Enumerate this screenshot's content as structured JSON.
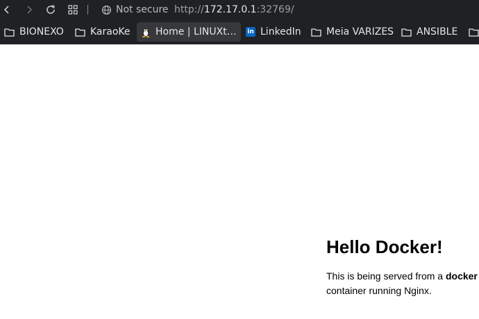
{
  "browser": {
    "security_label": "Not secure",
    "url": {
      "scheme": "http://",
      "host": "172.17.0.1",
      "rest": ":32769/"
    },
    "icons": {
      "back": "arrow-left-icon",
      "forward": "arrow-right-icon",
      "reload": "reload-icon",
      "apps": "apps-grid-icon",
      "security": "globe-icon"
    }
  },
  "bookmarks": [
    {
      "label": "BIONEXO",
      "icon": "folder-icon"
    },
    {
      "label": "KaraoKe",
      "icon": "folder-icon"
    },
    {
      "label": "Home | LINUXt…",
      "icon": "tux-icon"
    },
    {
      "label": "LinkedIn",
      "icon": "linkedin-icon",
      "badge": "in"
    },
    {
      "label": "Meia VARIZES",
      "icon": "folder-icon"
    },
    {
      "label": "ANSIBLE",
      "icon": "folder-icon"
    }
  ],
  "page": {
    "heading": "Hello Docker!",
    "text_before": "This is being served from a ",
    "text_bold": "docker",
    "text_after": " container running Nginx."
  }
}
